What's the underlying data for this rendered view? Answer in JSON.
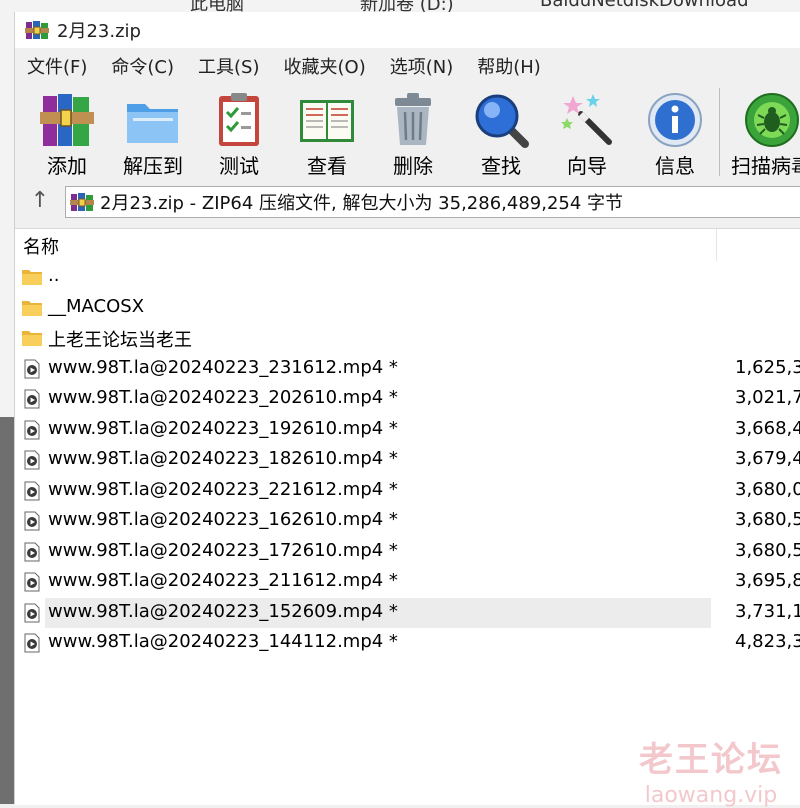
{
  "background_breadcrumb": [
    "此电脑",
    "新加卷 (D:)",
    "BaiduNetdiskDownload"
  ],
  "window": {
    "title": "2月23.zip"
  },
  "menu": [
    "文件(F)",
    "命令(C)",
    "工具(S)",
    "收藏夹(O)",
    "选项(N)",
    "帮助(H)"
  ],
  "toolbar": [
    {
      "label": "添加",
      "icon": "books-icon"
    },
    {
      "label": "解压到",
      "icon": "folder-extract-icon"
    },
    {
      "label": "测试",
      "icon": "clipboard-check-icon"
    },
    {
      "label": "查看",
      "icon": "open-book-icon"
    },
    {
      "label": "删除",
      "icon": "trash-can-icon"
    },
    {
      "label": "查找",
      "icon": "magnifier-icon"
    },
    {
      "label": "向导",
      "icon": "magic-wand-icon"
    },
    {
      "label": "信息",
      "icon": "info-icon"
    },
    {
      "label": "扫描病毒",
      "icon": "virus-scan-icon"
    }
  ],
  "address": {
    "text": "2月23.zip - ZIP64 压缩文件, 解包大小为 35,286,489,254 字节"
  },
  "columns": {
    "name": "名称"
  },
  "rows": [
    {
      "name": "..",
      "size": "",
      "type": "folder"
    },
    {
      "name": "__MACOSX",
      "size": "",
      "type": "folder"
    },
    {
      "name": "上老王论坛当老王",
      "size": "",
      "type": "folder"
    },
    {
      "name": "www.98T.la@20240223_231612.mp4 *",
      "size": "1,625,3",
      "type": "video"
    },
    {
      "name": "www.98T.la@20240223_202610.mp4 *",
      "size": "3,021,7",
      "type": "video"
    },
    {
      "name": "www.98T.la@20240223_192610.mp4 *",
      "size": "3,668,4",
      "type": "video"
    },
    {
      "name": "www.98T.la@20240223_182610.mp4 *",
      "size": "3,679,4",
      "type": "video"
    },
    {
      "name": "www.98T.la@20240223_221612.mp4 *",
      "size": "3,680,0",
      "type": "video"
    },
    {
      "name": "www.98T.la@20240223_162610.mp4 *",
      "size": "3,680,5",
      "type": "video"
    },
    {
      "name": "www.98T.la@20240223_172610.mp4 *",
      "size": "3,680,5",
      "type": "video"
    },
    {
      "name": "www.98T.la@20240223_211612.mp4 *",
      "size": "3,695,8",
      "type": "video"
    },
    {
      "name": "www.98T.la@20240223_152609.mp4 *",
      "size": "3,731,1",
      "type": "video"
    },
    {
      "name": "www.98T.la@20240223_144112.mp4 *",
      "size": "4,823,3",
      "type": "video"
    }
  ],
  "highlighted_row": 11,
  "watermark": {
    "cn": "老王论坛",
    "en": "laowang.vip"
  },
  "colors": {
    "selection": "#e5e5e5",
    "watermark": "#f3c8cc"
  }
}
